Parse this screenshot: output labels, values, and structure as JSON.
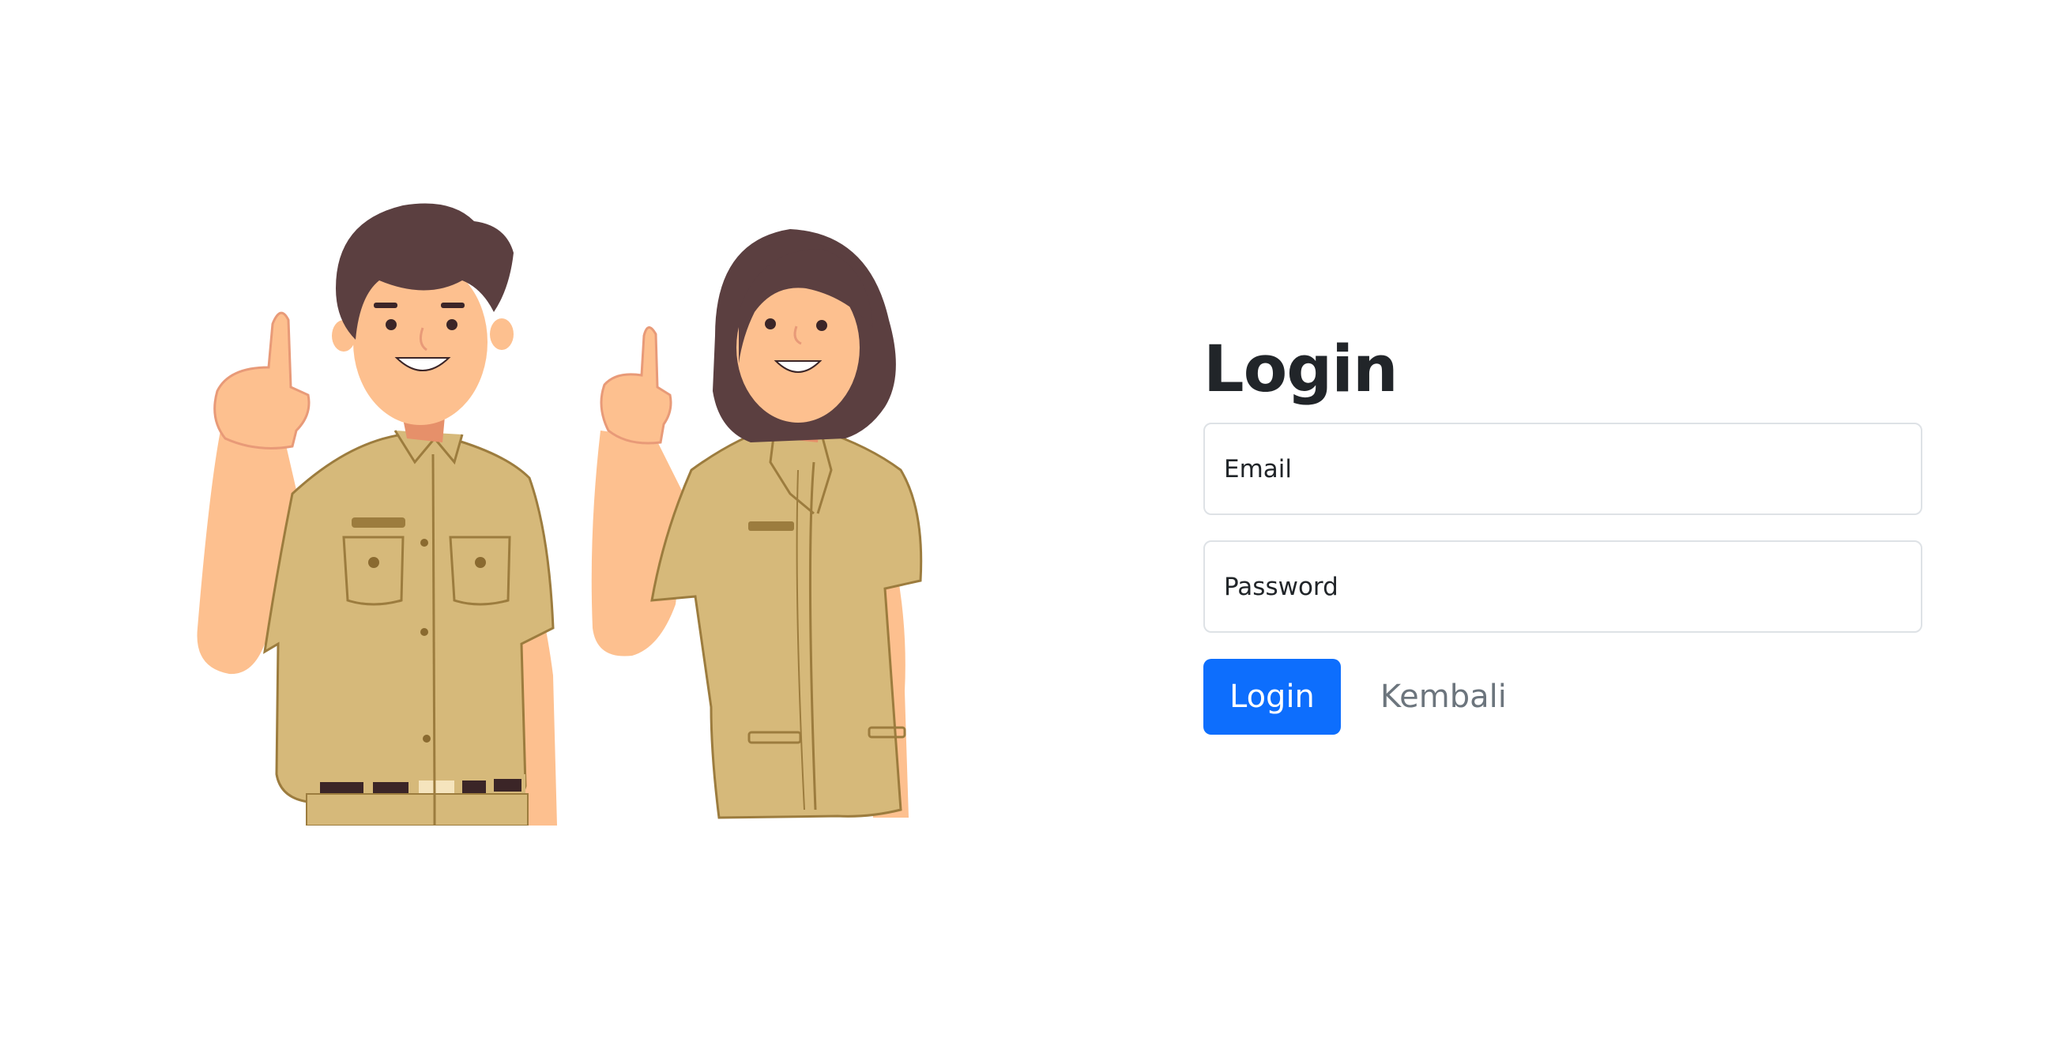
{
  "login": {
    "title": "Login",
    "email_placeholder": "Email",
    "password_placeholder": "Password",
    "submit_label": "Login",
    "back_link": "Kembali"
  },
  "colors": {
    "primary": "#0d6efd",
    "muted_link": "#6c757d",
    "heading": "#212529",
    "input_border": "#dee2e6",
    "uniform": "#d6b97a",
    "hair": "#5b3f40",
    "skin": "#fdc08f"
  }
}
